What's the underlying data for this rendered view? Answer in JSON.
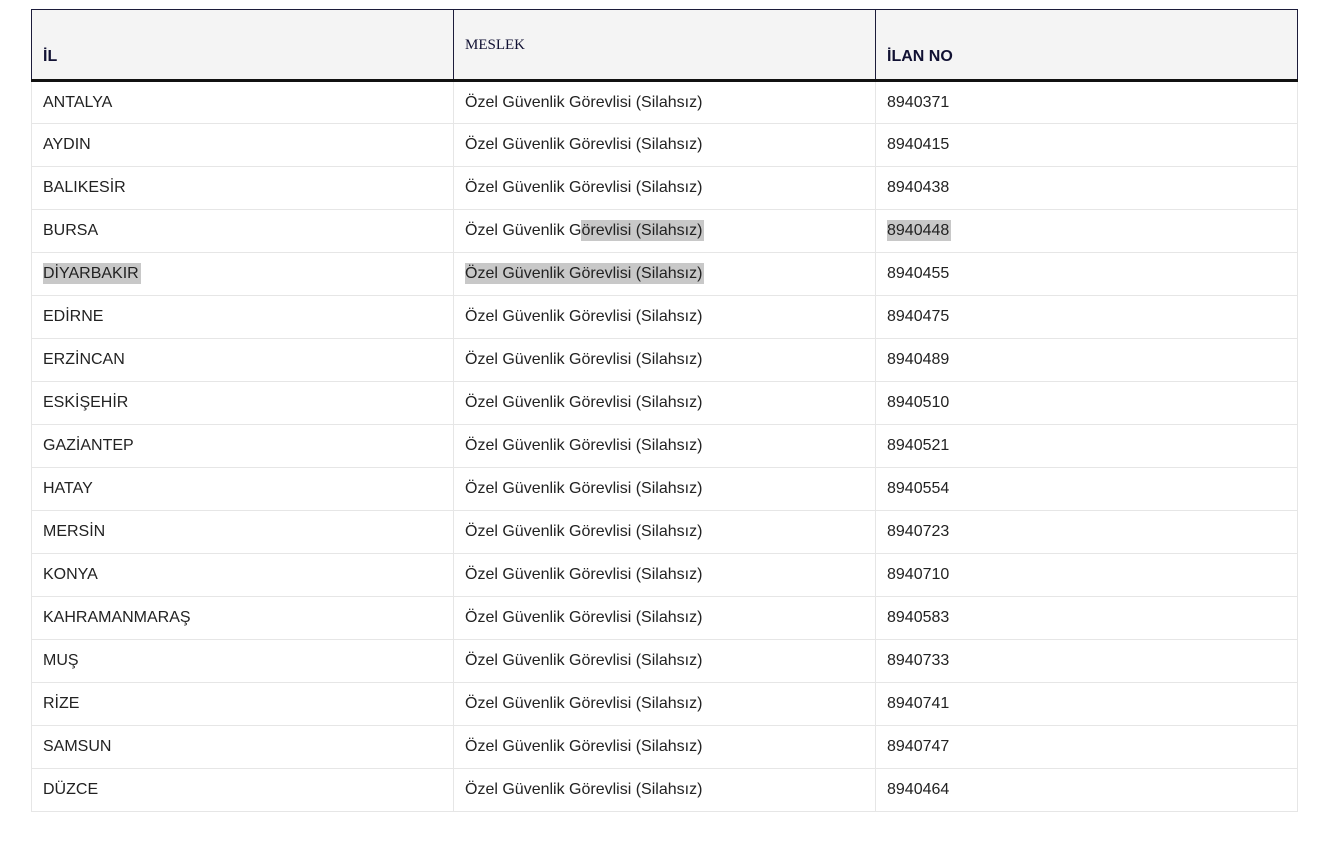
{
  "table": {
    "headers": [
      "İL",
      "MESLEK",
      "İLAN NO"
    ],
    "rows": [
      [
        "ANTALYA",
        "Özel Güvenlik Görevlisi (Silahsız)",
        "8940371"
      ],
      [
        "AYDIN",
        "Özel Güvenlik Görevlisi (Silahsız)",
        "8940415"
      ],
      [
        "BALIKESİR",
        "Özel Güvenlik Görevlisi (Silahsız)",
        "8940438"
      ],
      [
        "BURSA",
        "Özel Güvenlik Görevlisi (Silahsız)",
        "8940448"
      ],
      [
        "DİYARBAKIR",
        "Özel Güvenlik Görevlisi (Silahsız)",
        "8940455"
      ],
      [
        "EDİRNE",
        "Özel Güvenlik Görevlisi (Silahsız)",
        "8940475"
      ],
      [
        "ERZİNCAN",
        "Özel Güvenlik Görevlisi (Silahsız)",
        "8940489"
      ],
      [
        "ESKİŞEHİR",
        "Özel Güvenlik Görevlisi (Silahsız)",
        "8940510"
      ],
      [
        "GAZİANTEP",
        "Özel Güvenlik Görevlisi (Silahsız)",
        "8940521"
      ],
      [
        "HATAY",
        "Özel Güvenlik Görevlisi (Silahsız)",
        "8940554"
      ],
      [
        "MERSİN",
        "Özel Güvenlik Görevlisi (Silahsız)",
        "8940723"
      ],
      [
        "KONYA",
        "Özel Güvenlik Görevlisi (Silahsız)",
        "8940710"
      ],
      [
        "KAHRAMANMARAŞ",
        "Özel Güvenlik Görevlisi (Silahsız)",
        "8940583"
      ],
      [
        "MUŞ",
        "Özel Güvenlik Görevlisi (Silahsız)",
        "8940733"
      ],
      [
        "RİZE",
        "Özel Güvenlik Görevlisi (Silahsız)",
        "8940741"
      ],
      [
        "SAMSUN",
        "Özel Güvenlik Görevlisi (Silahsız)",
        "8940747"
      ],
      [
        "DÜZCE",
        "Özel Güvenlik Görevlisi (Silahsız)",
        "8940464"
      ]
    ],
    "selection": {
      "bursa_meslek_unselected_prefix": "Özel Güvenlik G",
      "bursa_meslek_selected_suffix": "örevlisi (Silahsız)"
    },
    "highlight_color": "#c8c8c8"
  }
}
